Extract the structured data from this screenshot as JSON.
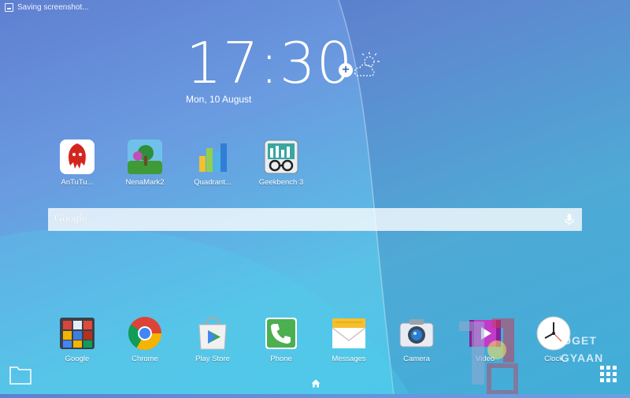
{
  "status_bar": {
    "notification_text": "Saving screenshot..."
  },
  "clock_widget": {
    "time": "17:30",
    "date": "Mon, 10 August"
  },
  "search_bar": {
    "placeholder": "Google"
  },
  "home_apps": [
    {
      "label": "AnTuTu..."
    },
    {
      "label": "NenaMark2"
    },
    {
      "label": "Quadrant..."
    },
    {
      "label": "Geekbench 3"
    }
  ],
  "dock_apps": [
    {
      "label": "Google"
    },
    {
      "label": "Chrome"
    },
    {
      "label": "Play Store"
    },
    {
      "label": "Phone"
    },
    {
      "label": "Messages"
    },
    {
      "label": "Camera"
    },
    {
      "label": "Video"
    },
    {
      "label": "Clock"
    }
  ],
  "watermark": {
    "line1": "DGET",
    "line2": "GYAAN"
  },
  "colors": {
    "accent": "#4a6fb5",
    "wallpaper_top": "#5f7fd0",
    "wallpaper_bottom": "#47c7ea"
  }
}
